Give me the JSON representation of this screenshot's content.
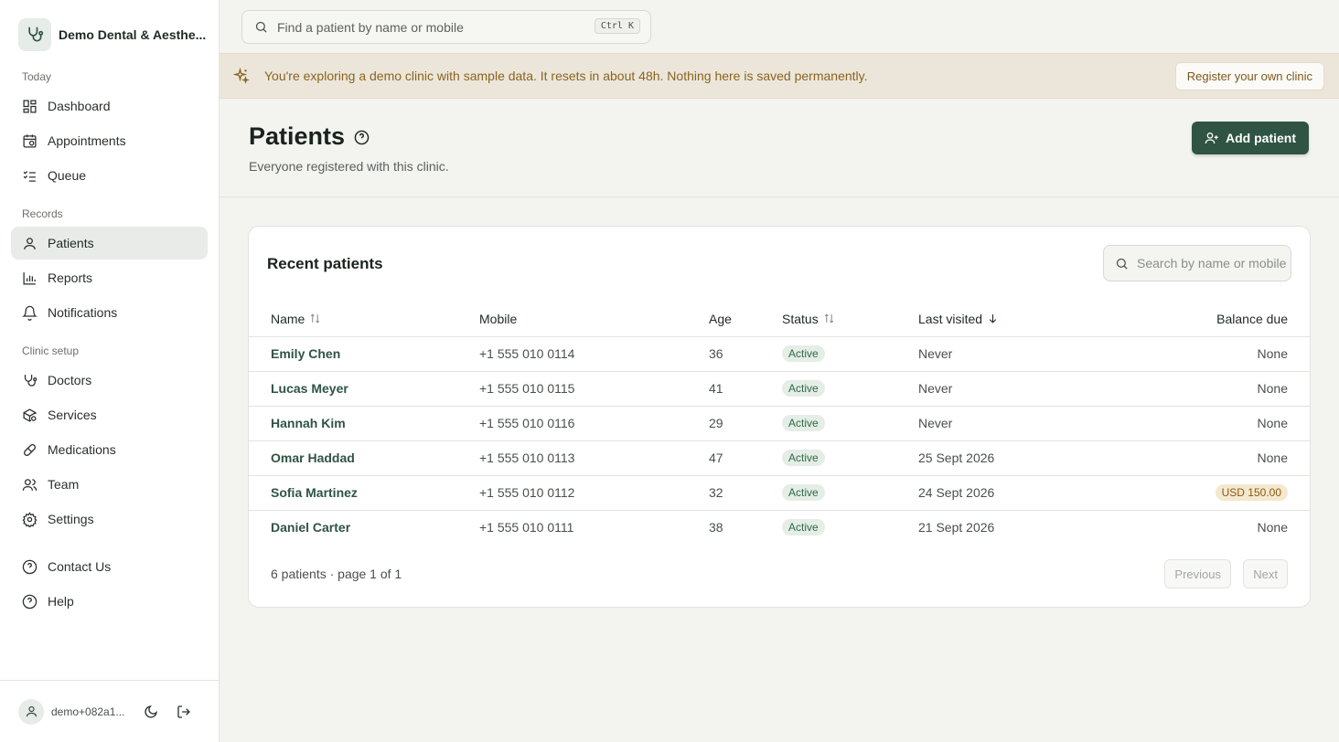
{
  "brand": {
    "name": "Demo Dental & Aesthe..."
  },
  "sidebar": {
    "sections": [
      {
        "label": "Today"
      },
      {
        "label": "Records"
      },
      {
        "label": "Clinic setup"
      }
    ],
    "items": [
      {
        "label": "Dashboard",
        "icon": "dashboard-icon"
      },
      {
        "label": "Appointments",
        "icon": "calendar-clock-icon"
      },
      {
        "label": "Queue",
        "icon": "list-checks-icon"
      },
      {
        "label": "Patients",
        "icon": "user-icon",
        "active": true
      },
      {
        "label": "Reports",
        "icon": "bar-chart-icon"
      },
      {
        "label": "Notifications",
        "icon": "bell-icon"
      },
      {
        "label": "Doctors",
        "icon": "stethoscope-icon"
      },
      {
        "label": "Services",
        "icon": "package-search-icon"
      },
      {
        "label": "Medications",
        "icon": "pill-icon"
      },
      {
        "label": "Team",
        "icon": "users-icon"
      },
      {
        "label": "Settings",
        "icon": "gear-icon"
      },
      {
        "label": "Contact Us",
        "icon": "help-circle-icon"
      },
      {
        "label": "Help",
        "icon": "help-circle-icon"
      }
    ],
    "user": {
      "email": "demo+082a1..."
    }
  },
  "search": {
    "placeholder": "Find a patient by name or mobile",
    "shortcut": "Ctrl K"
  },
  "banner": {
    "text": "You're exploring a demo clinic with sample data. It resets in about 48h. Nothing here is saved permanently.",
    "cta": "Register your own clinic"
  },
  "page": {
    "title": "Patients",
    "subtitle": "Everyone registered with this clinic.",
    "add_button": "Add patient"
  },
  "card": {
    "title": "Recent patients",
    "search_placeholder": "Search by name or mobile",
    "columns": {
      "name": "Name",
      "mobile": "Mobile",
      "age": "Age",
      "status": "Status",
      "last_visited": "Last visited",
      "balance": "Balance due"
    },
    "rows": [
      {
        "name": "Emily Chen",
        "mobile": "+1 555 010 0114",
        "age": "36",
        "status": "Active",
        "last_visited": "Never",
        "balance": "None",
        "balance_due": false
      },
      {
        "name": "Lucas Meyer",
        "mobile": "+1 555 010 0115",
        "age": "41",
        "status": "Active",
        "last_visited": "Never",
        "balance": "None",
        "balance_due": false
      },
      {
        "name": "Hannah Kim",
        "mobile": "+1 555 010 0116",
        "age": "29",
        "status": "Active",
        "last_visited": "Never",
        "balance": "None",
        "balance_due": false
      },
      {
        "name": "Omar Haddad",
        "mobile": "+1 555 010 0113",
        "age": "47",
        "status": "Active",
        "last_visited": "25 Sept 2026",
        "balance": "None",
        "balance_due": false
      },
      {
        "name": "Sofia Martinez",
        "mobile": "+1 555 010 0112",
        "age": "32",
        "status": "Active",
        "last_visited": "24 Sept 2026",
        "balance": "USD 150.00",
        "balance_due": true
      },
      {
        "name": "Daniel Carter",
        "mobile": "+1 555 010 0111",
        "age": "38",
        "status": "Active",
        "last_visited": "21 Sept 2026",
        "balance": "None",
        "balance_due": false
      }
    ],
    "footer": "6 patients · page 1 of 1",
    "prev": "Previous",
    "next": "Next"
  },
  "colors": {
    "accent": "#2f5443",
    "banner_bg": "#ece6da",
    "banner_text": "#8a6420",
    "status_bg": "#e4ede6",
    "balance_bg": "#f4e8cf"
  }
}
